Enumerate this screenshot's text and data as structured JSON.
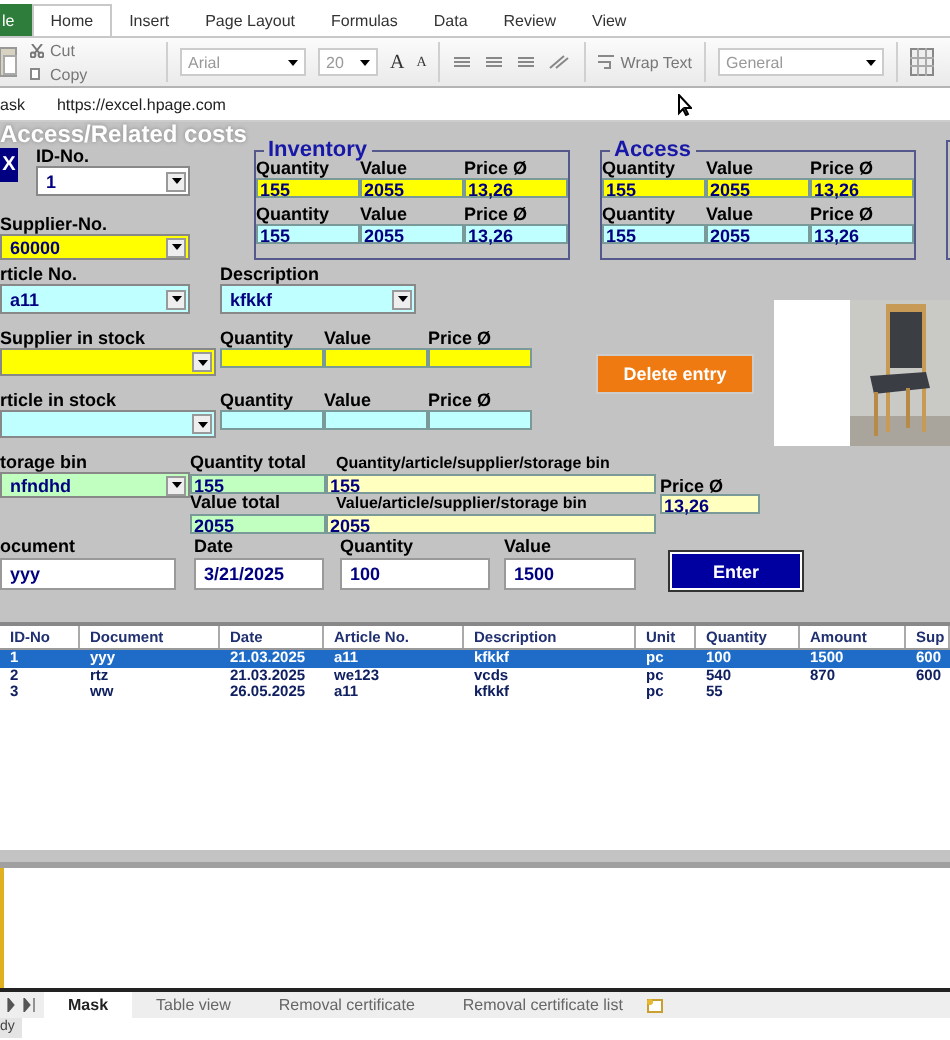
{
  "ribbon": {
    "tabs": [
      {
        "label": "le",
        "kind": "file",
        "selected": false
      },
      {
        "label": "Home",
        "kind": "tab",
        "selected": true
      },
      {
        "label": "Insert",
        "kind": "tab",
        "selected": false
      },
      {
        "label": "Page Layout",
        "kind": "tab",
        "selected": false
      },
      {
        "label": "Formulas",
        "kind": "tab",
        "selected": false
      },
      {
        "label": "Data",
        "kind": "tab",
        "selected": false
      },
      {
        "label": "Review",
        "kind": "tab",
        "selected": false
      },
      {
        "label": "View",
        "kind": "tab",
        "selected": false
      }
    ]
  },
  "toolbar": {
    "cut": "Cut",
    "copy": "Copy",
    "font": "Arial",
    "size": "20",
    "grow": "A",
    "shrink": "A",
    "wrap": "Wrap Text",
    "format": "General"
  },
  "formula_bar": {
    "name_box": "ask",
    "value": "https://excel.hpage.com"
  },
  "form": {
    "title": "Access/Related costs",
    "close": "X",
    "id": {
      "label": "ID-No.",
      "value": "1"
    },
    "supplier": {
      "label": "Supplier-No.",
      "value": "60000"
    },
    "groups": [
      {
        "title": "Inventory",
        "rows": [
          {
            "color": "#ffff00",
            "cells": [
              {
                "label": "Quantity",
                "value": "155"
              },
              {
                "label": "Value",
                "value": "2055"
              },
              {
                "label": "Price Ø",
                "value": "13,26"
              }
            ]
          },
          {
            "color": "#c0ffff",
            "cells": [
              {
                "label": "Quantity",
                "value": "155"
              },
              {
                "label": "Value",
                "value": "2055"
              },
              {
                "label": "Price Ø",
                "value": "13,26"
              }
            ]
          }
        ]
      },
      {
        "title": "Access",
        "rows": [
          {
            "color": "#ffff00",
            "cells": [
              {
                "label": "Quantity",
                "value": "155"
              },
              {
                "label": "Value",
                "value": "2055"
              },
              {
                "label": "Price Ø",
                "value": "13,26"
              }
            ]
          },
          {
            "color": "#c0ffff",
            "cells": [
              {
                "label": "Quantity",
                "value": "155"
              },
              {
                "label": "Value",
                "value": "2055"
              },
              {
                "label": "Price Ø",
                "value": "13,26"
              }
            ]
          }
        ]
      }
    ],
    "article": {
      "label": "rticle No.",
      "value": "a11"
    },
    "description": {
      "label": "Description",
      "value": "kfkkf"
    },
    "stock": [
      {
        "label": "Supplier in stock",
        "color": "#ffff00",
        "cells": [
          {
            "label": "Quantity"
          },
          {
            "label": "Value"
          },
          {
            "label": "Price Ø"
          }
        ]
      },
      {
        "label": "rticle in stock",
        "color": "#c0ffff",
        "cells": [
          {
            "label": "Quantity"
          },
          {
            "label": "Value"
          },
          {
            "label": "Price Ø"
          }
        ]
      }
    ],
    "delete_button": "Delete entry",
    "storage": {
      "label": "torage bin",
      "value": "nfndhd"
    },
    "totals": {
      "quantity_label": "Quantity total",
      "quantity": "155",
      "quantity_detail_label": "Quantity/article/supplier/storage bin",
      "quantity_detail": "155",
      "value_label": "Value total",
      "value": "2055",
      "value_detail_label": "Value/article/supplier/storage bin",
      "value_detail": "2055",
      "price_label": "Price Ø",
      "price": "13,26"
    },
    "entry": [
      {
        "label": "ocument",
        "value": "yyy"
      },
      {
        "label": "Date",
        "value": "3/21/2025"
      },
      {
        "label": "Quantity",
        "value": "100"
      },
      {
        "label": "Value",
        "value": "1500"
      }
    ],
    "enter_button": "Enter",
    "table": {
      "columns": [
        "ID-No",
        "Document",
        "Date",
        "Article No.",
        "Description",
        "Unit",
        "Quantity",
        "Amount",
        "Sup"
      ],
      "rows": [
        {
          "selected": true,
          "cells": [
            "1",
            "yyy",
            "21.03.2025",
            "a11",
            "kfkkf",
            "pc",
            "100",
            "1500",
            "600"
          ]
        },
        {
          "selected": false,
          "cells": [
            "2",
            "rtz",
            "21.03.2025",
            "we123",
            "vcds",
            "pc",
            "540",
            "870",
            "600"
          ]
        },
        {
          "selected": false,
          "cells": [
            "3",
            "ww",
            "26.05.2025",
            "a11",
            "kfkkf",
            "pc",
            "55"
          ]
        }
      ]
    }
  },
  "sheet_tabs": [
    {
      "label": "Mask",
      "selected": true
    },
    {
      "label": "Table view",
      "selected": false
    },
    {
      "label": "Removal certificate",
      "selected": false
    },
    {
      "label": "Removal certificate list",
      "selected": false
    }
  ],
  "status_bar": "dy"
}
